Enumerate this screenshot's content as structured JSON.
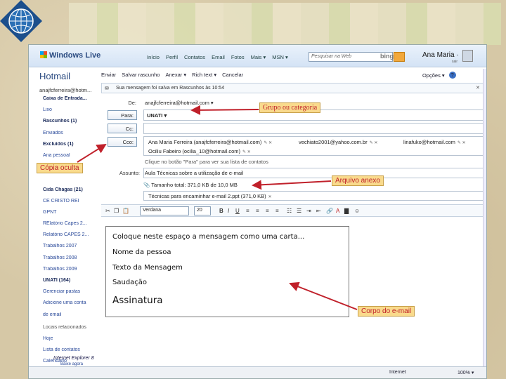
{
  "topbar": {
    "brand": "Windows Live",
    "nav": [
      "Início",
      "Perfil",
      "Contatos",
      "Email",
      "Fotos",
      "Mais ▾",
      "MSN ▾"
    ],
    "search_placeholder": "Pesquisar na Web",
    "bing": "bing",
    "user_name": "Ana Maria ·",
    "user_sub": "sair"
  },
  "sidebar": {
    "title": "Hotmail",
    "email": "anajfcferreira@hotm...",
    "items": [
      {
        "label": "Caixa de Entrada...",
        "bold": true
      },
      {
        "label": "Lixo",
        "bold": false
      },
      {
        "label": "Rascunhos (1)",
        "bold": true
      },
      {
        "label": "Enviados",
        "bold": false
      },
      {
        "label": "Excluídos (1)",
        "bold": true
      },
      {
        "label": "Ana pessoal",
        "bold": false
      },
      {
        "label": "",
        "bold": false
      },
      {
        "label": "",
        "bold": false
      },
      {
        "label": "Cida Chagas (21)",
        "bold": true
      },
      {
        "label": "CE CRISTO REI",
        "bold": false
      },
      {
        "label": "GPNT",
        "bold": false
      },
      {
        "label": "RElatório Capes 2...",
        "bold": false
      },
      {
        "label": "Relatório CAPES 2...",
        "bold": false
      },
      {
        "label": "Trabalhos 2007",
        "bold": false
      },
      {
        "label": "Trabalhos 2008",
        "bold": false
      },
      {
        "label": "Trabalhos 2009",
        "bold": false
      },
      {
        "label": "UNATI (164)",
        "bold": true
      },
      {
        "label": "Gerenciar pastas",
        "bold": false
      },
      {
        "label": "Adicione uma conta",
        "bold": false
      },
      {
        "label": "de email",
        "bold": false
      },
      {
        "label": "Locais relacionados",
        "bold": false,
        "head": true
      },
      {
        "label": "Hoje",
        "bold": false
      },
      {
        "label": "Lista de contatos",
        "bold": false
      },
      {
        "label": "Calendário",
        "bold": false
      }
    ]
  },
  "toolbar": {
    "items": [
      "Enviar",
      "Salvar rascunho",
      "Anexar ▾",
      "Rich text ▾",
      "Cancelar"
    ],
    "options": "Opções ▾",
    "help": "?"
  },
  "info_bar": {
    "text": "Sua mensagem foi salva em Rascunhos às 10:54",
    "close": "✕"
  },
  "compose": {
    "from_label": "De:",
    "from_value": "anajfcferreira@hotmail.com ▾",
    "to_label": "Para:",
    "to_chip": "UNATI ▾",
    "cc_label": "Cc:",
    "bcc_label": "Cco:",
    "bcc_chips": [
      "Ana Maria Ferreira (anajfcferreira@hotmail.com)",
      "vechiato2001@yahoo.com.br",
      "linafuko@hotmail.com",
      "Ociliu Fabeiro (ocilia_10@hotmail.com)"
    ],
    "hint": "Clique no botão \"Para\" para ver sua lista de contatos",
    "subject_label": "Assunto:",
    "subject_value": "Aula Técnicas sobre a utilização de e-mail",
    "attach_total": "Tamanho total: 371,0 KB de 10,0 MB",
    "attach_file": "Técnicas para encaminhar e-mail 2.ppt (371,0 KB)"
  },
  "format": {
    "font": "Verdana",
    "size": "20"
  },
  "body": {
    "lines": [
      "Coloque neste espaço a mensagem como uma carta...",
      "Nome da pessoa",
      "Texto da Mensagem",
      "Saudação",
      "Assinatura"
    ]
  },
  "status": {
    "ie_logo": "Internet Explorer 8",
    "ie_sub": "Baixe agora",
    "zone": "Internet",
    "zoom": "100% ▾"
  },
  "callouts": {
    "grupo": "Grupo ou categoria",
    "copia": "Cópia oculta",
    "arquivo": "Arquivo anexo",
    "corpo": "Corpo do e-mail"
  },
  "colors": {
    "callout_bg": "#f9da8c",
    "callout_text": "#c0202a",
    "arrow": "#c0202a",
    "brand_blue": "#2a4a80"
  }
}
